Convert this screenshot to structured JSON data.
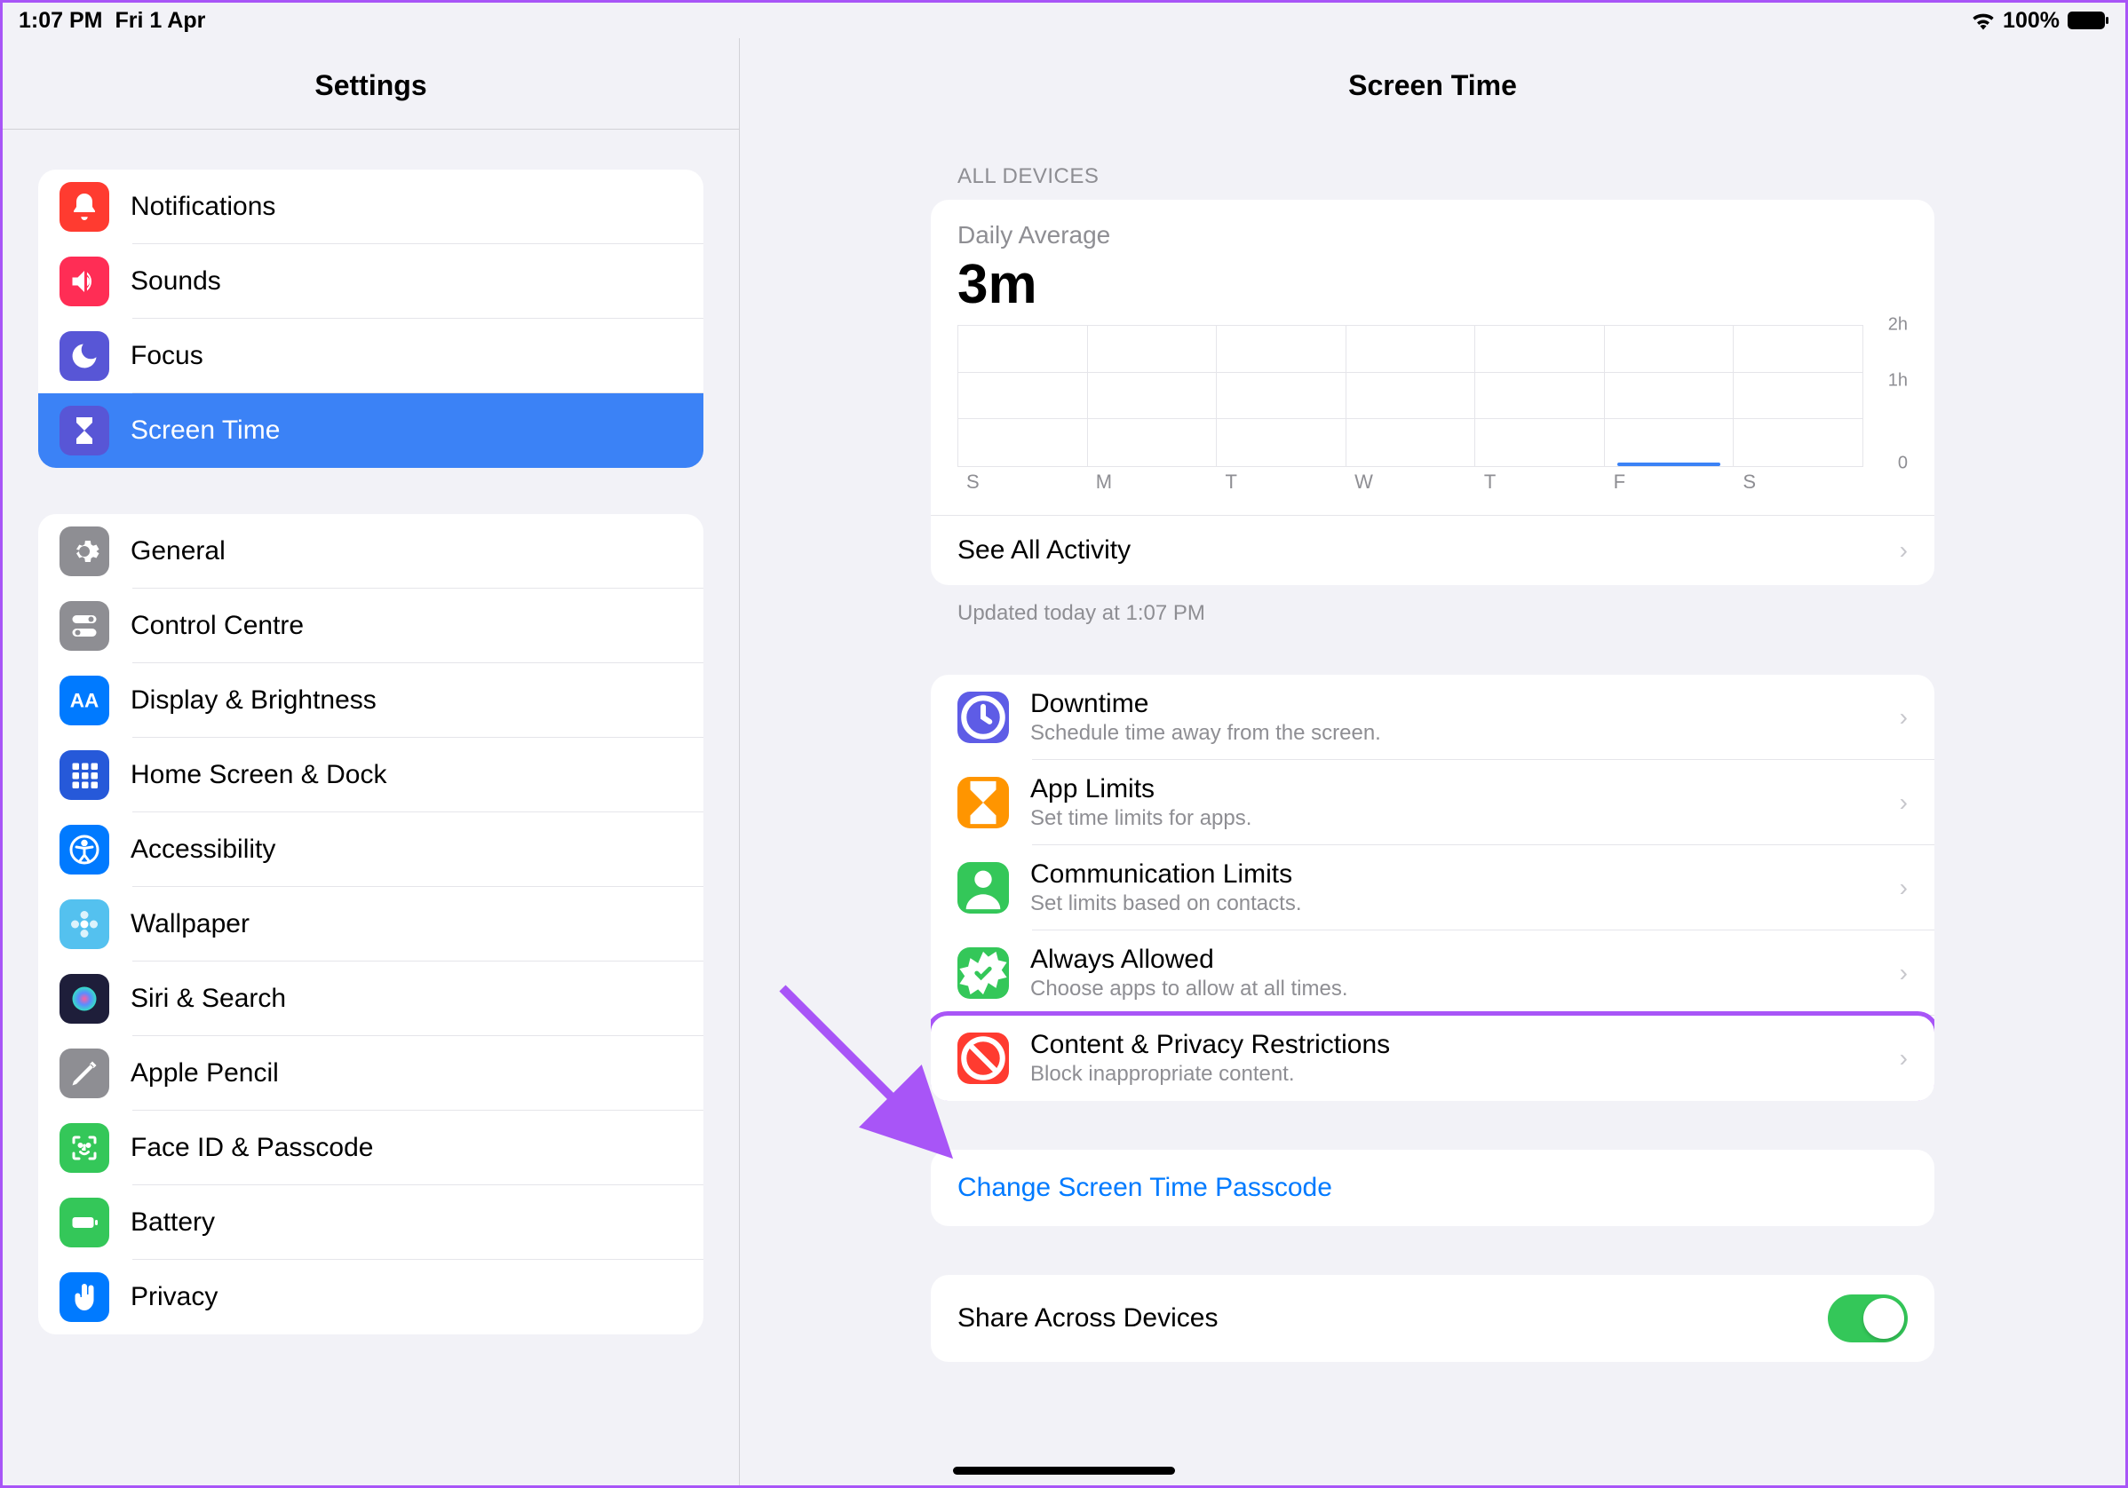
{
  "status": {
    "time": "1:07 PM",
    "date": "Fri 1 Apr",
    "battery": "100%"
  },
  "sidebar": {
    "title": "Settings",
    "group0": [
      {
        "label": "Notifications",
        "bg": "#ff3b30",
        "icon": "bell"
      },
      {
        "label": "Sounds",
        "bg": "#ff2d55",
        "icon": "speaker"
      },
      {
        "label": "Focus",
        "bg": "#5856d6",
        "icon": "moon"
      },
      {
        "label": "Screen Time",
        "bg": "#5856d6",
        "icon": "hourglass",
        "selected": true
      }
    ],
    "group1": [
      {
        "label": "General",
        "bg": "#8e8e93",
        "icon": "gear"
      },
      {
        "label": "Control Centre",
        "bg": "#8e8e93",
        "icon": "toggles"
      },
      {
        "label": "Display & Brightness",
        "bg": "#007aff",
        "icon": "aa"
      },
      {
        "label": "Home Screen & Dock",
        "bg": "#2659d9",
        "icon": "grid"
      },
      {
        "label": "Accessibility",
        "bg": "#007aff",
        "icon": "accessibility"
      },
      {
        "label": "Wallpaper",
        "bg": "#54c1ef",
        "icon": "flower"
      },
      {
        "label": "Siri & Search",
        "bg": "#1e1e3a",
        "icon": "siri"
      },
      {
        "label": "Apple Pencil",
        "bg": "#8e8e93",
        "icon": "pencil"
      },
      {
        "label": "Face ID & Passcode",
        "bg": "#34c759",
        "icon": "faceid"
      },
      {
        "label": "Battery",
        "bg": "#34c759",
        "icon": "battery"
      },
      {
        "label": "Privacy",
        "bg": "#007aff",
        "icon": "hand"
      }
    ]
  },
  "main": {
    "title": "Screen Time",
    "sectionHeader": "ALL DEVICES",
    "dailyLabel": "Daily Average",
    "dailyValue": "3m",
    "seeAll": "See All Activity",
    "updated": "Updated today at 1:07 PM",
    "options": [
      {
        "title": "Downtime",
        "sub": "Schedule time away from the screen.",
        "bg": "#5e5ce6",
        "icon": "clock"
      },
      {
        "title": "App Limits",
        "sub": "Set time limits for apps.",
        "bg": "#ff9500",
        "icon": "hourglass"
      },
      {
        "title": "Communication Limits",
        "sub": "Set limits based on contacts.",
        "bg": "#34c759",
        "icon": "person"
      },
      {
        "title": "Always Allowed",
        "sub": "Choose apps to allow at all times.",
        "bg": "#34c759",
        "icon": "check"
      },
      {
        "title": "Content & Privacy Restrictions",
        "sub": "Block inappropriate content.",
        "bg": "#ff3b30",
        "icon": "nosymbol",
        "highlight": true
      }
    ],
    "changePasscode": "Change Screen Time Passcode",
    "shareAcross": "Share Across Devices"
  },
  "chart_data": {
    "type": "bar",
    "categories": [
      "S",
      "M",
      "T",
      "W",
      "T",
      "F",
      "S"
    ],
    "values": [
      0,
      0,
      0,
      0,
      0,
      3,
      0
    ],
    "ylabels": [
      "2h",
      "1h",
      "0"
    ],
    "ylim": [
      0,
      120
    ],
    "title": "Daily Average"
  }
}
